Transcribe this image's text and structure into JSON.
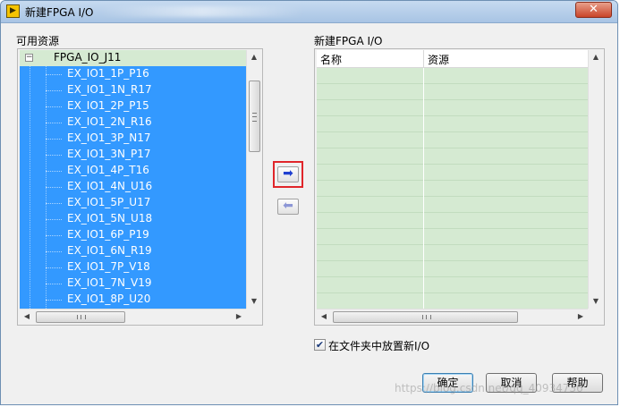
{
  "window": {
    "title": "新建FPGA I/O",
    "close_glyph": "✕"
  },
  "available": {
    "label": "可用资源",
    "root": "FPGA_IO_J11",
    "items": [
      "EX_IO1_1P_P16",
      "EX_IO1_1N_R17",
      "EX_IO1_2P_P15",
      "EX_IO1_2N_R16",
      "EX_IO1_3P_N17",
      "EX_IO1_3N_P17",
      "EX_IO1_4P_T16",
      "EX_IO1_4N_U16",
      "EX_IO1_5P_U17",
      "EX_IO1_5N_U18",
      "EX_IO1_6P_P19",
      "EX_IO1_6N_R19",
      "EX_IO1_7P_V18",
      "EX_IO1_7N_V19",
      "EX_IO1_8P_U20"
    ]
  },
  "new_io": {
    "label": "新建FPGA I/O",
    "columns": [
      "名称",
      "资源"
    ],
    "row_count": 15
  },
  "arrows": {
    "add": "➡",
    "remove": "⬅"
  },
  "options": {
    "place_in_folder": "在文件夹中放置新I/O",
    "checked": true,
    "check_glyph": "✔"
  },
  "buttons": {
    "ok": "确定",
    "cancel": "取消",
    "help": "帮助"
  },
  "scroll_glyphs": {
    "up": "▲",
    "down": "▼",
    "left": "◀",
    "right": "▶"
  },
  "watermark": "https://blog.csdn.net/qq_40934736",
  "colors": {
    "selection": "#3399ff",
    "table_bg": "#d5ead2",
    "highlight": "#e0252a"
  }
}
